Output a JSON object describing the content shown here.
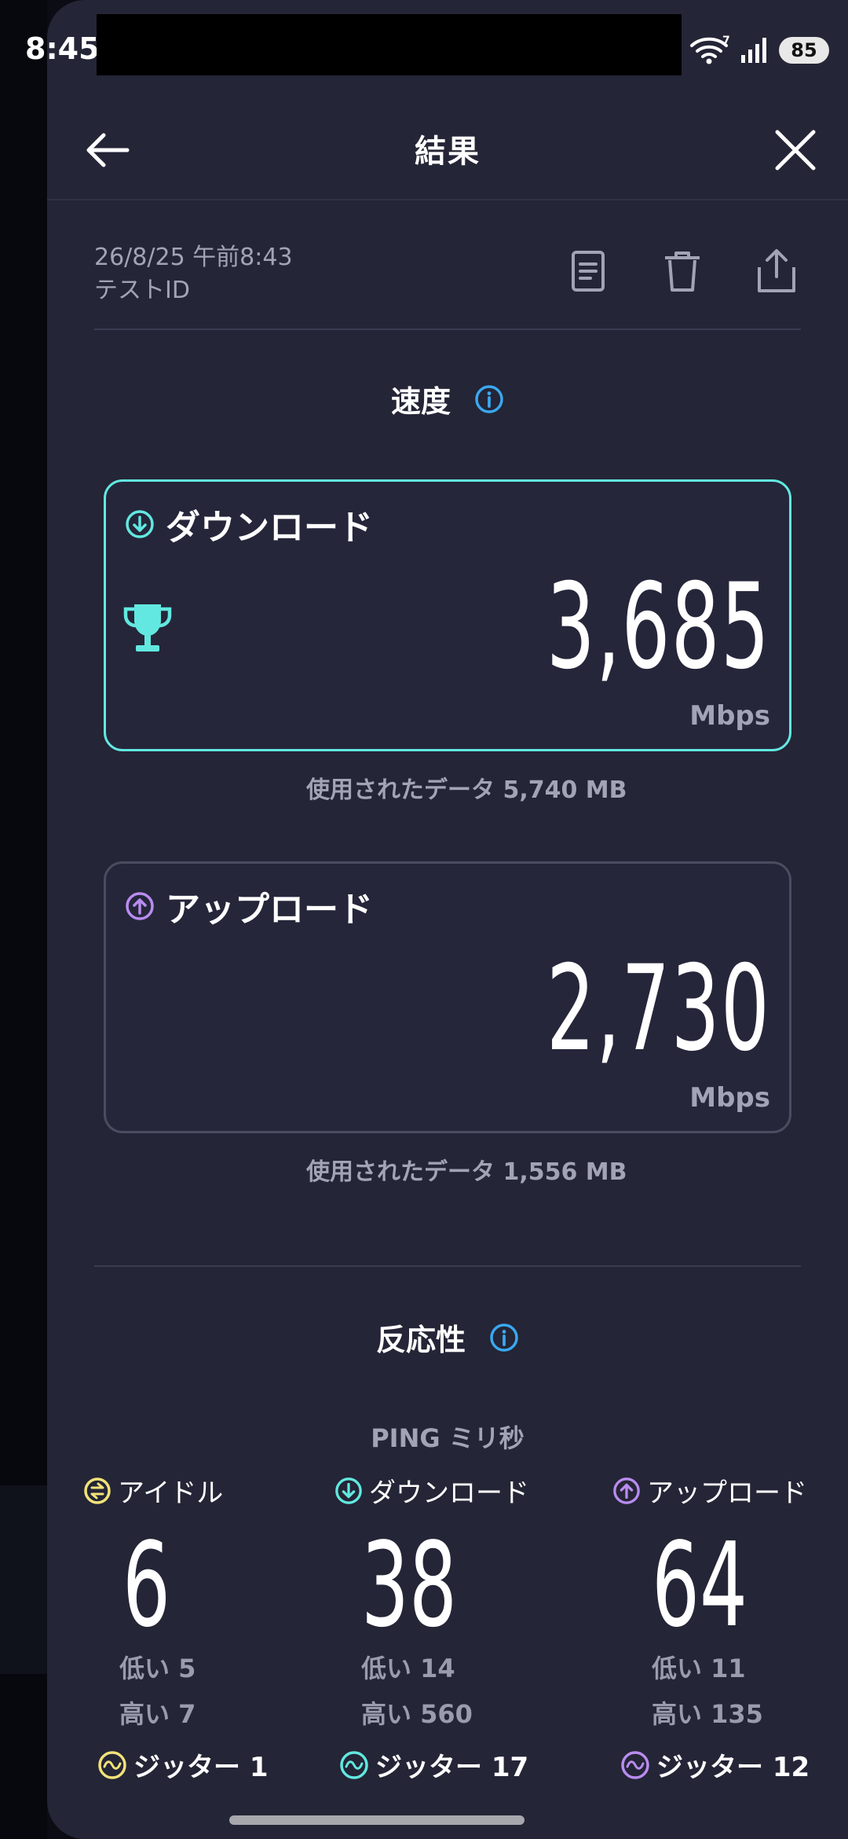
{
  "status": {
    "time": "8:45",
    "battery": "85",
    "wifi_badge": "7"
  },
  "header": {
    "title": "結果"
  },
  "meta": {
    "date": "26/8/25 午前8:43",
    "test_id": "テストID"
  },
  "speed": {
    "section_title": "速度",
    "download": {
      "label": "ダウンロード",
      "value": "3,685",
      "unit": "Mbps",
      "data_used": "使用されたデータ 5,740 MB"
    },
    "upload": {
      "label": "アップロード",
      "value": "2,730",
      "unit": "Mbps",
      "data_used": "使用されたデータ 1,556 MB"
    }
  },
  "responsiveness": {
    "section_title": "反応性",
    "ping_title": "PING ミリ秒",
    "columns": [
      {
        "label": "アイドル",
        "value": "6",
        "low": "低い 5",
        "high": "高い 7",
        "jitter": "ジッター 1",
        "color": "#f2e27a"
      },
      {
        "label": "ダウンロード",
        "value": "38",
        "low": "低い 14",
        "high": "高い 560",
        "jitter": "ジッター 17",
        "color": "#62e8e0"
      },
      {
        "label": "アップロード",
        "value": "64",
        "low": "低い 11",
        "high": "高い 135",
        "jitter": "ジッター 12",
        "color": "#b98cf0"
      }
    ]
  },
  "colors": {
    "accent_download": "#62e8e0",
    "accent_upload": "#b98cf0",
    "accent_idle": "#f2e27a",
    "info": "#3aa8f0",
    "sheet_bg": "#242536"
  }
}
